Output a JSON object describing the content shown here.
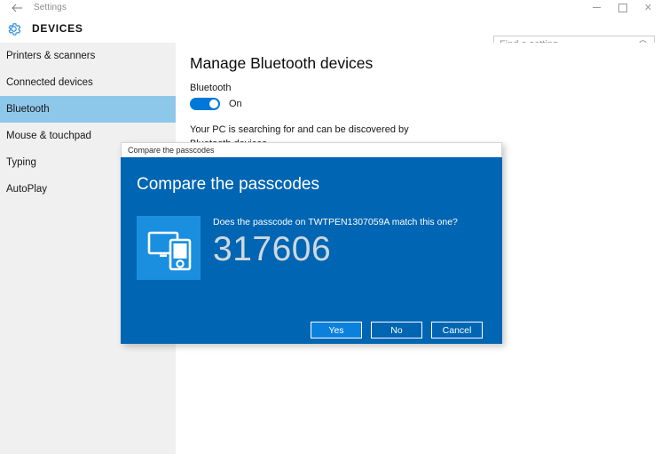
{
  "window": {
    "back_icon": "back-arrow-icon",
    "title": "Settings",
    "minimize_label": "",
    "maximize_label": "",
    "close_label": "✕"
  },
  "header": {
    "icon": "gear-icon",
    "title": "DEVICES"
  },
  "search": {
    "placeholder": "Find a setting",
    "icon": "search-icon"
  },
  "sidebar": {
    "items": [
      {
        "label": "Printers & scanners",
        "selected": false
      },
      {
        "label": "Connected devices",
        "selected": false
      },
      {
        "label": "Bluetooth",
        "selected": true
      },
      {
        "label": "Mouse & touchpad",
        "selected": false
      },
      {
        "label": "Typing",
        "selected": false
      },
      {
        "label": "AutoPlay",
        "selected": false
      }
    ],
    "selected_color": "#8dc8ea"
  },
  "main": {
    "page_title": "Manage Bluetooth devices",
    "bluetooth_label": "Bluetooth",
    "toggle_state": "On",
    "toggle_on": true,
    "status_text": "Your PC is searching for and can be discovered by Bluetooth devices."
  },
  "dialog": {
    "titlebar_text": "Compare the passcodes",
    "heading": "Compare the passcodes",
    "icon": "pc-and-phone-icon",
    "question": "Does the passcode on TWTPEN1307059A match this one?",
    "passcode": "317606",
    "buttons": [
      {
        "label": "Yes",
        "primary": true
      },
      {
        "label": "No",
        "primary": false
      },
      {
        "label": "Cancel",
        "primary": false
      }
    ],
    "accent_color": "#0065b3",
    "primary_button_color": "#0b81dd",
    "icon_tile_color": "#1a8fe0"
  }
}
